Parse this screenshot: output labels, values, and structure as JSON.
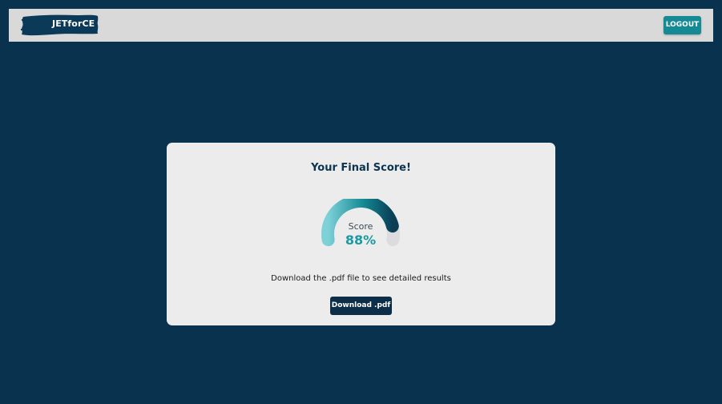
{
  "header": {
    "brand": "JETforCE",
    "logout_label": "LOGOUT"
  },
  "result": {
    "title": "Your Final Score!",
    "gauge_label": "Score",
    "score_text": "88%",
    "score_fraction": 0.88,
    "info": "Download the .pdf file to see detailed results",
    "download_label": "Download .pdf"
  },
  "colors": {
    "background": "#08324e",
    "header_bg": "#d9d9d9",
    "accent_teal": "#138a94",
    "gauge_start": "#7fd1d8",
    "gauge_end": "#0b3d55",
    "gauge_track": "#dcdcde",
    "score_color": "#1a9aa2",
    "dark_button": "#0d2e48",
    "card_bg": "#ececed"
  },
  "icons": {
    "brand_mark": "brush-stroke-logo"
  }
}
